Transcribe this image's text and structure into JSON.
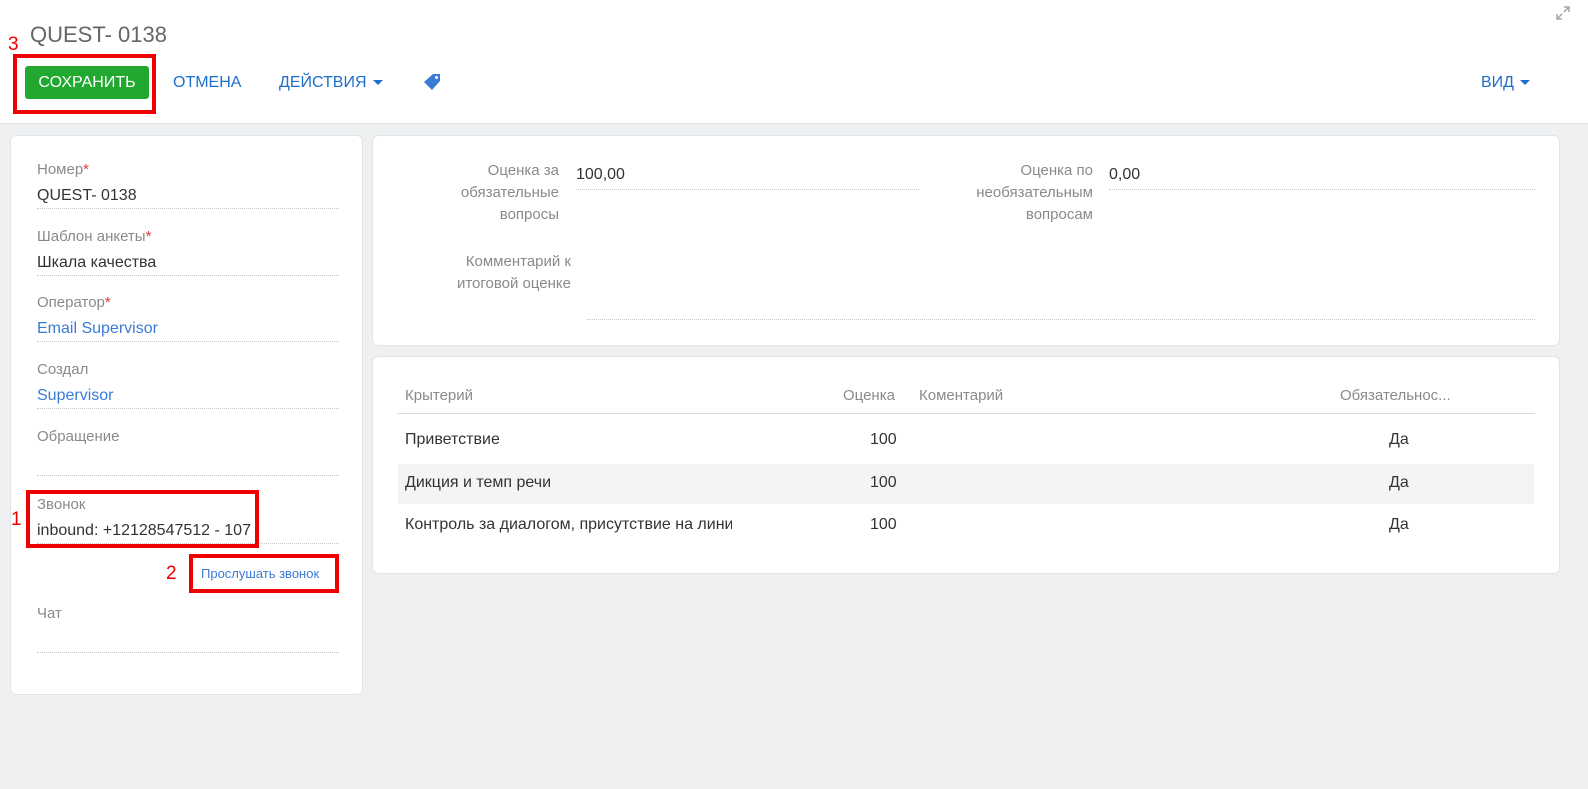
{
  "header": {
    "title": "QUEST- 0138",
    "save_label": "СОХРАНИТЬ",
    "cancel_label": "ОТМЕНА",
    "actions_label": "ДЕЙСТВИЯ",
    "view_label": "ВИД"
  },
  "annotations": [
    "1",
    "2",
    "3"
  ],
  "left": {
    "number": {
      "label": "Номер",
      "value": "QUEST- 0138"
    },
    "template": {
      "label": "Шаблон анкеты",
      "value": "Шкала качества"
    },
    "operator": {
      "label": "Оператор",
      "value": "Email Supervisor"
    },
    "created_by": {
      "label": "Создал",
      "value": "Supervisor"
    },
    "appeal": {
      "label": "Обращение",
      "value": ""
    },
    "call": {
      "label": "Звонок",
      "value": "inbound: +12128547512 - 107"
    },
    "listen_link": "Прослушать звонок",
    "chat": {
      "label": "Чат",
      "value": ""
    }
  },
  "summary": {
    "mandatory_label_1": "Оценка за",
    "mandatory_label_2": "обязательные",
    "mandatory_label_3": "вопросы",
    "mandatory_value": "100,00",
    "optional_label_1": "Оценка по",
    "optional_label_2": "необязательным",
    "optional_label_3": "вопросам",
    "optional_value": "0,00",
    "comment_label_1": "Комментарий к",
    "comment_label_2": "итоговой оценке",
    "comment_value": ""
  },
  "grid": {
    "columns": [
      "Крытерий",
      "Оценка",
      "Коментарий",
      "Обязательнос..."
    ],
    "rows": [
      {
        "criterion": "Приветствие",
        "score": "100",
        "comment": "",
        "required": "Да"
      },
      {
        "criterion": "Дикция и темп речи",
        "score": "100",
        "comment": "",
        "required": "Да"
      },
      {
        "criterion": "Контроль за диалогом, присутствие на линии",
        "score": "100",
        "comment": "",
        "required": "Да"
      }
    ]
  },
  "colors": {
    "accent": "#1d6fcb",
    "save": "#21a92f",
    "annotation": "#ee0000"
  }
}
